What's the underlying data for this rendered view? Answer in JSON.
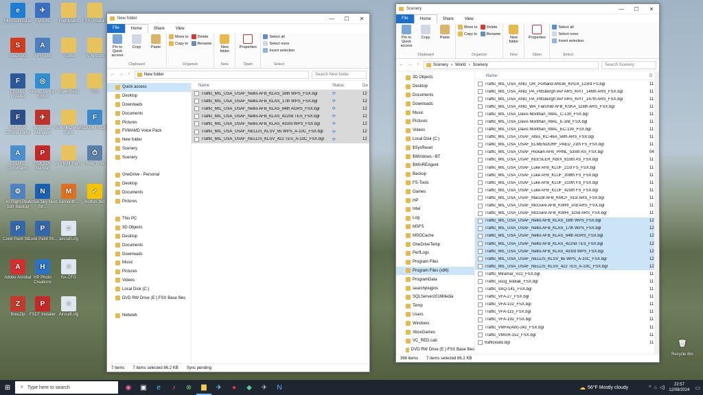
{
  "desktop_icons": [
    {
      "label": "Microsoft Edge",
      "color": "#1b7fd6",
      "glyph": "e",
      "icon": "edge-icon"
    },
    {
      "label": "Flyroute",
      "color": "#3a6fc2",
      "glyph": "✈",
      "icon": "plane-icon"
    },
    {
      "label": "Flightplans",
      "color": "#e8c25a",
      "glyph": "",
      "icon": "folder-icon"
    },
    {
      "label": "FSX Program",
      "color": "#e8c25a",
      "glyph": "",
      "icon": "folder-icon"
    },
    {
      "label": "SnapShot",
      "color": "#d43a1c",
      "glyph": "S",
      "icon": "snapshot-icon"
    },
    {
      "label": "AIFP Lite",
      "color": "#4a7fc0",
      "glyph": "A",
      "icon": "aifp-icon"
    },
    {
      "label": "Traffic",
      "color": "#e8c25a",
      "glyph": "",
      "icon": "folder-icon"
    },
    {
      "label": "AI Aircraft",
      "color": "#e8c25a",
      "glyph": "",
      "icon": "folder-icon"
    },
    {
      "label": "FSUIPC Installer",
      "color": "#2a5a9c",
      "glyph": "F",
      "icon": "installer-icon"
    },
    {
      "label": "Airport Design Editor",
      "color": "#2f8fd0",
      "glyph": "◎",
      "icon": "globe-icon"
    },
    {
      "label": "Downloads",
      "color": "#e8c25a",
      "glyph": "",
      "icon": "folder-icon"
    },
    {
      "label": "FSX",
      "color": "#e8c25a",
      "glyph": "",
      "icon": "folder-icon"
    },
    {
      "label": "FSX SP2 Control Panel",
      "color": "#2a4d8c",
      "glyph": "F",
      "icon": "panel-icon"
    },
    {
      "label": "AI Aircraft Manager",
      "color": "#c0312b",
      "glyph": "✈",
      "icon": "manager-icon"
    },
    {
      "label": "FVMAMD Voice Pack",
      "color": "#e8c25a",
      "glyph": "",
      "icon": "folder-icon"
    },
    {
      "label": "FS2004 Installer",
      "color": "#3c89c9",
      "glyph": "F",
      "icon": "setup-icon"
    },
    {
      "label": "FSUIPC Documents",
      "color": "#4a90d0",
      "glyph": "A",
      "icon": "docs-icon"
    },
    {
      "label": "FSX SDK Manual",
      "color": "#c62828",
      "glyph": "P",
      "icon": "pdf-icon"
    },
    {
      "label": "AI Flight Plans",
      "color": "#e8c25a",
      "glyph": "",
      "icon": "folder-icon"
    },
    {
      "label": "Real Time",
      "color": "#5a7fa8",
      "glyph": "⏱",
      "icon": "clock-icon"
    },
    {
      "label": "AI Flight Plan Sort Backup",
      "color": "#4e84c4",
      "glyph": "⚙",
      "icon": "tool-icon"
    },
    {
      "label": "Active Sky Next for...",
      "color": "#1a5fb4",
      "glyph": "N",
      "icon": "activesky-icon"
    },
    {
      "label": "Airmooth...",
      "color": "#e07020",
      "glyph": "M",
      "icon": "airmooth-icon"
    },
    {
      "label": "Norton 360",
      "color": "#f5c400",
      "glyph": "✓",
      "icon": "norton-icon"
    },
    {
      "label": "Corel Paint Sh...",
      "color": "#3366aa",
      "glyph": "P",
      "icon": "paintshop-icon"
    },
    {
      "label": "Corel Paint Sh...",
      "color": "#3366aa",
      "glyph": "P",
      "icon": "paintshop-icon"
    },
    {
      "label": "aircraft.cfg",
      "color": "#dfe7f0",
      "glyph": "≡",
      "icon": "cfg-icon"
    },
    {
      "label": "Adobe Acrobat",
      "color": "#d32f2f",
      "glyph": "A",
      "icon": "acrobat-icon"
    },
    {
      "label": "HP Photo Creations",
      "color": "#2a72c4",
      "glyph": "H",
      "icon": "hp-icon"
    },
    {
      "label": "fsx.CFG",
      "color": "#dfe7f0",
      "glyph": "≡",
      "icon": "cfg-icon"
    },
    {
      "label": "BreeZip",
      "color": "#c43a2a",
      "glyph": "Z",
      "icon": "zip-icon"
    },
    {
      "label": "FSDT Installer",
      "color": "#c62828",
      "glyph": "P",
      "icon": "pdf-icon"
    },
    {
      "label": "Aircraft.cfg",
      "color": "#dfe7f0",
      "glyph": "≡",
      "icon": "cfg-icon"
    },
    {
      "label": "Recycle Bin",
      "color": "#7a8a99",
      "glyph": "🗑",
      "icon": "recycle-bin-icon"
    }
  ],
  "ribbon": {
    "tab_file": "File",
    "tab_home": "Home",
    "tab_share": "Share",
    "tab_view": "View",
    "pin": "Pin to Quick access",
    "copy": "Copy",
    "paste": "Paste",
    "move_to": "Move to",
    "copy_to": "Copy to",
    "delete": "Delete",
    "rename": "Rename",
    "new_folder": "New folder",
    "properties": "Properties",
    "select_all": "Select all",
    "select_none": "Select none",
    "invert": "Invert selection",
    "g_clipboard": "Clipboard",
    "g_organize": "Organize",
    "g_new": "New",
    "g_open": "Open",
    "g_select": "Select"
  },
  "win1": {
    "title": "New folder",
    "path": "New folder",
    "search": "Search New folder",
    "col_name": "Name",
    "col_status": "Status",
    "col_date": "Da",
    "nav": [
      {
        "label": "Quick access",
        "sel": true
      },
      {
        "label": "Desktop"
      },
      {
        "label": "Downloads"
      },
      {
        "label": "Documents"
      },
      {
        "label": "Pictures"
      },
      {
        "label": "FVMAMD Voice Pack"
      },
      {
        "label": "New folder"
      },
      {
        "label": "Scenery"
      },
      {
        "label": "Scenery"
      },
      {
        "label": ""
      },
      {
        "label": "OneDrive - Personal"
      },
      {
        "label": "Desktop"
      },
      {
        "label": "Documents"
      },
      {
        "label": "Pictures"
      },
      {
        "label": ""
      },
      {
        "label": "This PC"
      },
      {
        "label": "3D Objects"
      },
      {
        "label": "Desktop"
      },
      {
        "label": "Documents"
      },
      {
        "label": "Downloads"
      },
      {
        "label": "Music"
      },
      {
        "label": "Pictures"
      },
      {
        "label": "Videos"
      },
      {
        "label": "Local Disk (C:)"
      },
      {
        "label": "DVD RW Drive (E:) FSX Base files"
      },
      {
        "label": ""
      },
      {
        "label": "Network"
      }
    ],
    "files": [
      "Traffic_MIL_USA_USAF_Nellis AFB_KLAS_16th WPS_FSX.bgl",
      "Traffic_MIL_USA_USAF_Nellis AFB_KLAS_17th WPS_FSX.bgl",
      "Traffic_MIL_USA_USAF_Nellis AFB_KLAS_64th AGRS_FSX.bgl",
      "Traffic_MIL_USA_USAF_Nellis AFB_KLAS_422nd TES_FSX.bgl",
      "Traffic_MIL_USA_USAF_Nellis AFB_KLAS_433rd WPS_FSX.bgl",
      "Traffic_MIL_USA_USAF_NELLIS_KLSV_65 WPS_A-10C_FSX.bgl",
      "Traffic_MIL_USA_USAF_NELLIS_KLSV_422 TES_A-10C_FSX.bgl"
    ],
    "date_prefix": "12",
    "status_items": "7 items",
    "status_sel": "7 items selected 86.2 KB",
    "status_sync": "Sync pending"
  },
  "win2": {
    "title": "Scenery",
    "path_parts": [
      "Scenery",
      "World",
      "Scenery"
    ],
    "search": "Search Scenery",
    "col_name": "Name",
    "col_date": "D",
    "nav": [
      {
        "label": "3D Objects"
      },
      {
        "label": "Desktop"
      },
      {
        "label": "Documents"
      },
      {
        "label": "Downloads"
      },
      {
        "label": "Music"
      },
      {
        "label": "Pictures"
      },
      {
        "label": "Videos"
      },
      {
        "label": "Local Disk (C:)"
      },
      {
        "label": "$SysReset"
      },
      {
        "label": "$Windows.~BT"
      },
      {
        "label": "$WinREAgent"
      },
      {
        "label": "Backup"
      },
      {
        "label": "FS-Tools"
      },
      {
        "label": "Games"
      },
      {
        "label": "HP"
      },
      {
        "label": "Intel"
      },
      {
        "label": "Log"
      },
      {
        "label": "MSFS"
      },
      {
        "label": "MSOCache"
      },
      {
        "label": "OneDriveTemp"
      },
      {
        "label": "PerfLogs"
      },
      {
        "label": "Program Files"
      },
      {
        "label": "Program Files (x86)",
        "sel": true
      },
      {
        "label": "ProgramData"
      },
      {
        "label": "searchplugins"
      },
      {
        "label": "SQLServer2016Media"
      },
      {
        "label": "Temp"
      },
      {
        "label": "Users"
      },
      {
        "label": "Windows"
      },
      {
        "label": "XboxGames"
      },
      {
        "label": "VC_RED.cab"
      },
      {
        "label": "DVD RW Drive (E:) FSX Base files"
      }
    ],
    "files": [
      {
        "n": "Traffic_MIL_USA_ANG_OR_Portland ANGB_KPDX_123rd FS.bgl",
        "d": "11"
      },
      {
        "n": "Traffic_MIL_USA_ANG_PA_Pittsburgh IAP ARS_KPIT_146th ARS_FSX.bgl",
        "d": "11"
      },
      {
        "n": "Traffic_MIL_USA_ANG_PA_Pittsburgh IAP ARS_KPIT_147th ARS_FSX.bgl",
        "d": "11"
      },
      {
        "n": "Traffic_MIL_USA_ANG_WA_Fairchild AFB_KSKA_116th ARS_FSX.bgl",
        "d": "11"
      },
      {
        "n": "Traffic_MIL_USA_Davis Monthan_IWAL_C-130_FSX.bgl",
        "d": "11"
      },
      {
        "n": "Traffic_MIL_USA_Davis Monthan_IWAL_E-3/B_FSX.bgl",
        "d": "11"
      },
      {
        "n": "Traffic_MIL_USA_Davis Monthan_IWAL_EC-130_FSX.bgl",
        "d": "11"
      },
      {
        "n": "Traffic_MIL_USA_USAF_Altus_KC-46A_56th ARS_FSX.bgl",
        "d": "11"
      },
      {
        "n": "Traffic_MIL_USA_USAF_ELMENDORF_PAED_21th FS_FSX.bgl",
        "d": "11"
      },
      {
        "n": "Traffic_MIL_USA_USAF_Hickam AFB_PHNL_535th AS_FSX.bgl",
        "d": "04"
      },
      {
        "n": "Traffic_MIL_USA_USAF_KEESLER_KBIX_815th AS_FSX.bgl",
        "d": "11"
      },
      {
        "n": "Traffic_MIL_USA_USAF_Luke AFB_KLUF_21st FS_FSX.bgl",
        "d": "11"
      },
      {
        "n": "Traffic_MIL_USA_USAF_Luke AFB_KLUF_308th FS_FSX.bgl",
        "d": "11"
      },
      {
        "n": "Traffic_MIL_USA_USAF_Luke AFB_KLUF_310th FS_FSX.bgl",
        "d": "11"
      },
      {
        "n": "Traffic_MIL_USA_USAF_Luke AFB_KLUF_425th FS_FSX.bgl",
        "d": "11"
      },
      {
        "n": "Traffic_MIL_USA_USAF_MacDill AFB_KMCF_91st ARS_FSX.bgl",
        "d": "11"
      },
      {
        "n": "Traffic_MIL_USA_USAF_McGuire AFB_KWRI_2nd ARS_FSX.bgl",
        "d": "11"
      },
      {
        "n": "Traffic_MIL_USA_USAF_McGuire AFB_KWRI_32nd ARS_FSX.bgl",
        "d": "11"
      },
      {
        "n": "Traffic_MIL_USA_USAF_Nellis AFB_KLAS_16th WPS_FSX.bgl",
        "d": "12",
        "s": true
      },
      {
        "n": "Traffic_MIL_USA_USAF_Nellis AFB_KLAS_17th WPS_FSX.bgl",
        "d": "12",
        "s": true
      },
      {
        "n": "Traffic_MIL_USA_USAF_Nellis AFB_KLAS_64th AGRS_FSX.bgl",
        "d": "12",
        "s": true
      },
      {
        "n": "Traffic_MIL_USA_USAF_Nellis AFB_KLAS_422nd TES_FSX.bgl",
        "d": "12",
        "s": true
      },
      {
        "n": "Traffic_MIL_USA_USAF_Nellis AFB_KLAS_433rd WPS_FSX.bgl",
        "d": "12",
        "s": true
      },
      {
        "n": "Traffic_MIL_USA_USAF_NELLIS_KLSV_65 WPS_A-10C_FSX.bgl",
        "d": "12",
        "s": true
      },
      {
        "n": "Traffic_MIL_USA_USAF_NELLIS_KLSV_422 TES_A-10C_FSX.bgl",
        "d": "12",
        "s": true
      },
      {
        "n": "Traffic_Miramar_V22_FSX.bgl",
        "d": "11"
      },
      {
        "n": "Traffic_uscg_kodiak_FSX.bgl",
        "d": "11"
      },
      {
        "n": "Traffic_VAQ-141_FSX.bgl",
        "d": "11"
      },
      {
        "n": "Traffic_VFA-27_FSX.bgl",
        "d": "11"
      },
      {
        "n": "Traffic_VFA-102_FSX.bgl",
        "d": "11"
      },
      {
        "n": "Traffic_VFA-115_FSX.bgl",
        "d": "11"
      },
      {
        "n": "Traffic_VFA-192_FSX.bgl",
        "d": "11"
      },
      {
        "n": "Traffic_VMFA(AW)-242_FSX.bgl",
        "d": "11"
      },
      {
        "n": "Traffic_VMGR-152_FSX.bgl",
        "d": "11"
      },
      {
        "n": "trafficloats.bgl",
        "d": "11"
      }
    ],
    "status_items": "368 items",
    "status_sel": "7 items selected 86.2 KB"
  },
  "taskbar": {
    "search": "Type here to search",
    "weather": "56°F  Mostly cloudy",
    "time": "22:57",
    "date": "12/08/2024"
  }
}
